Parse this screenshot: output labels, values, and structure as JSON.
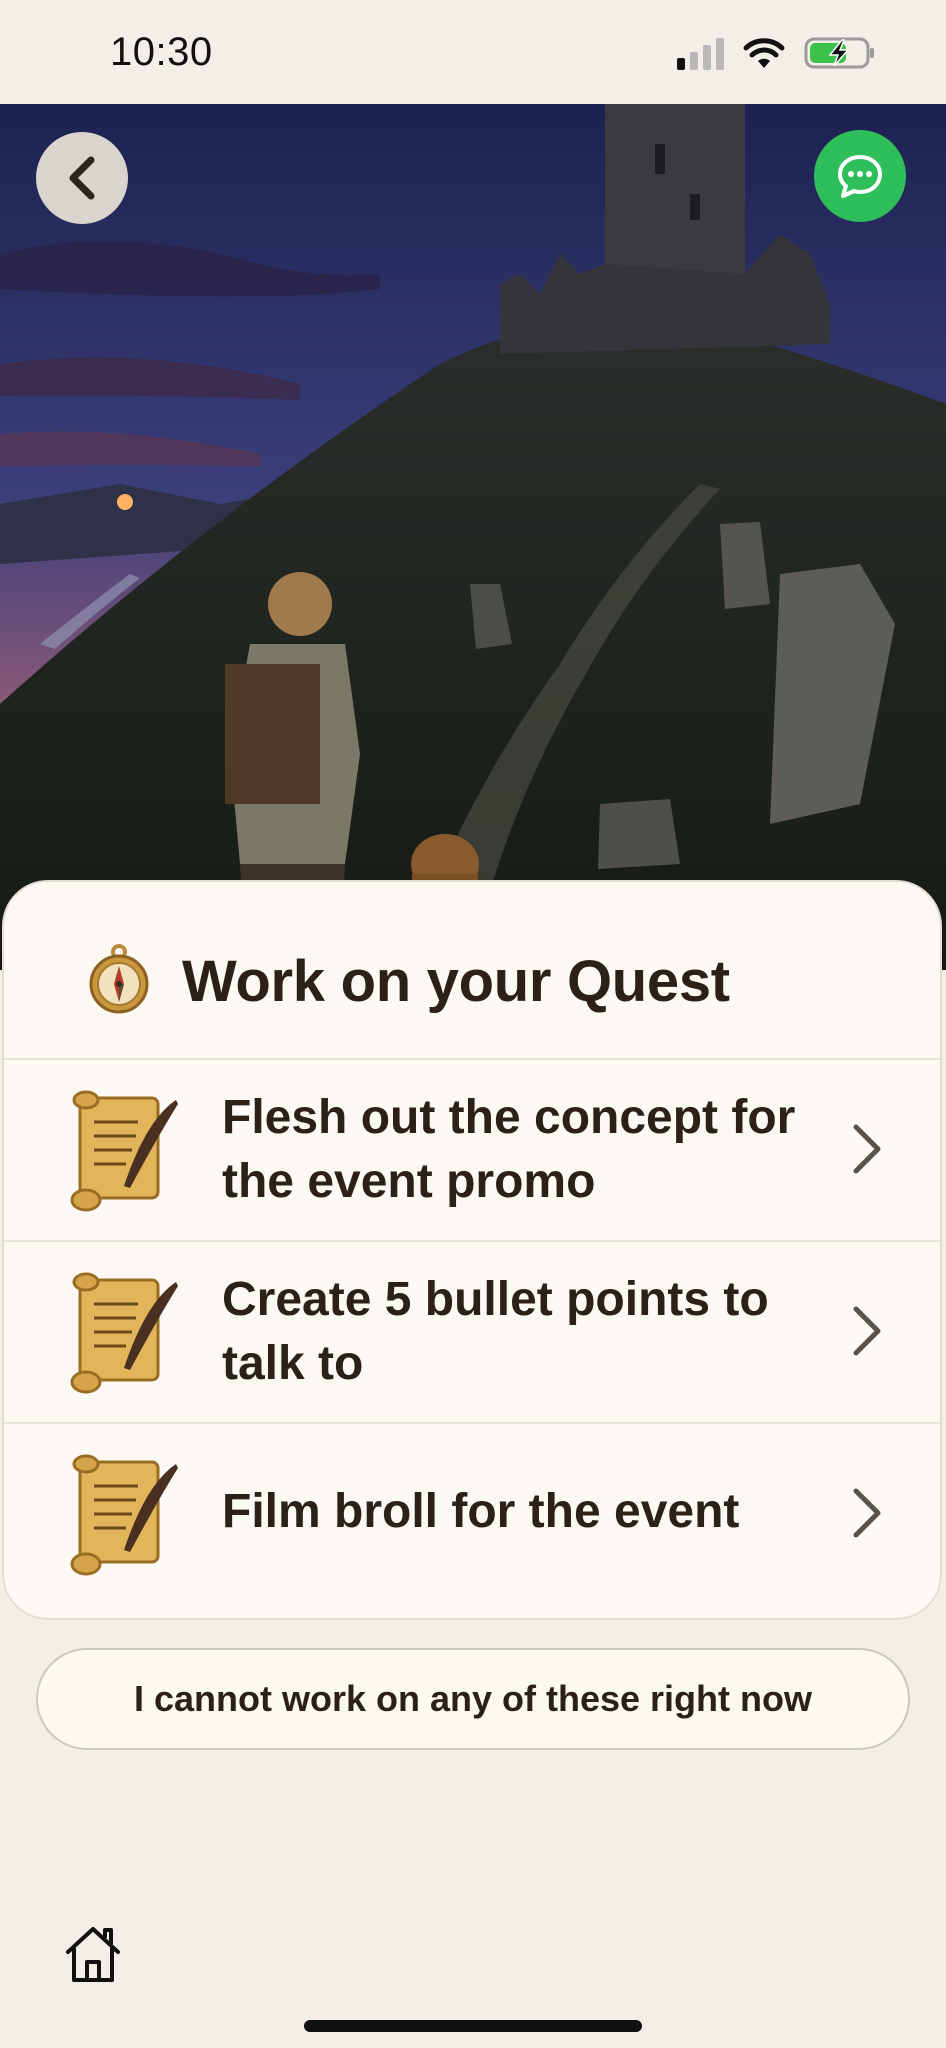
{
  "status_bar": {
    "time": "10:30"
  },
  "hero": {
    "back_icon": "chevron-left-icon",
    "chat_icon": "chat-bubble-icon"
  },
  "card": {
    "title": "Work on your Quest",
    "title_icon": "compass-icon",
    "quests": [
      {
        "icon": "scroll-quill-icon",
        "label": "Flesh out the concept for the event promo"
      },
      {
        "icon": "scroll-quill-icon",
        "label": "Create 5 bullet points to talk to"
      },
      {
        "icon": "scroll-quill-icon",
        "label": "Film broll for the event"
      }
    ]
  },
  "not_now_button": {
    "label": "I cannot work on any of these right now"
  },
  "bottom_nav": {
    "home_icon": "home-icon"
  },
  "colors": {
    "background": "#f3efe8",
    "card": "#fcf9f4",
    "chat_button": "#2fbf5a",
    "text": "#2b2118"
  }
}
